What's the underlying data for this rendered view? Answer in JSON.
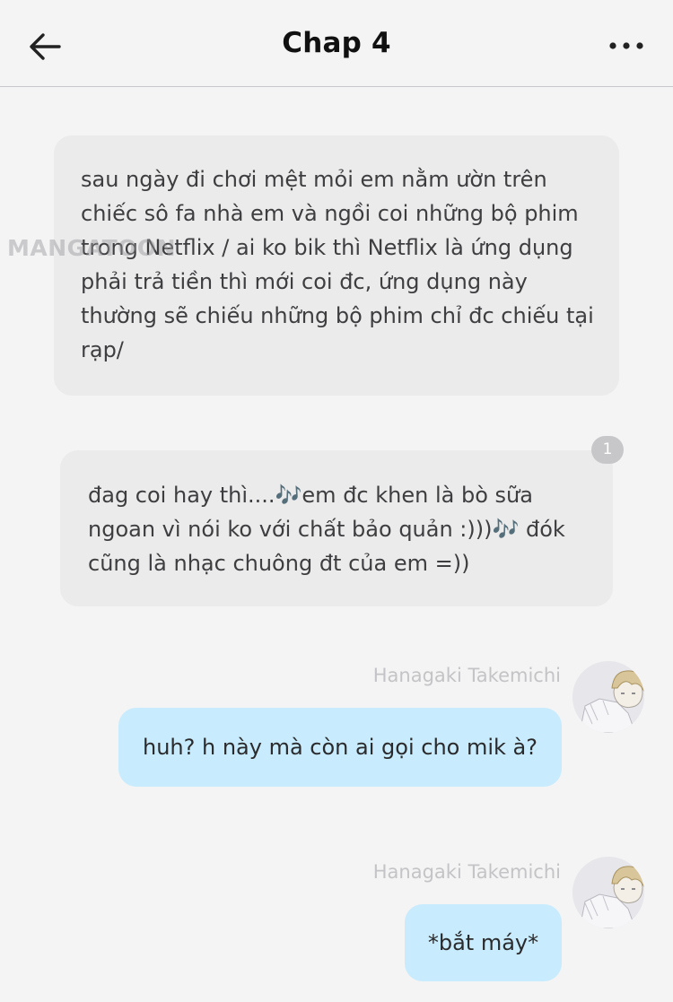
{
  "header": {
    "title": "Chap 4",
    "back_icon": "arrow-left-icon",
    "more_icon": "more-horizontal-icon"
  },
  "watermark": "MANGATOON",
  "messages": [
    {
      "type": "narration",
      "text": "sau ngày đi chơi mệt mỏi em nằm ườn trên chiếc sô fa nhà em và ngồi coi những bộ phim trong Netflix / ai ko bik thì Netflix là ứng dụng phải trả tiền thì mới coi đc, ứng dụng này thường sẽ chiếu những bộ phim chỉ đc chiếu tại rạp/"
    },
    {
      "type": "narration",
      "text": "đag coi hay thì....🎶em đc khen là bò sữa ngoan vì nói ko với chất bảo quản :)))🎶 đók cũng là nhạc chuông đt của em =))",
      "badge": "1"
    },
    {
      "type": "outgoing",
      "sender": "Hanagaki Takemichi",
      "text": "huh? h này mà còn ai gọi cho mik à?"
    },
    {
      "type": "outgoing",
      "sender": "Hanagaki Takemichi",
      "text": "*bắt máy*"
    }
  ],
  "colors": {
    "background": "#f4f4f5",
    "narration_bubble": "#ebebec",
    "outgoing_bubble": "#c8ecfd",
    "sender_name": "#c4c4c6",
    "badge": "#c7c7c9"
  }
}
